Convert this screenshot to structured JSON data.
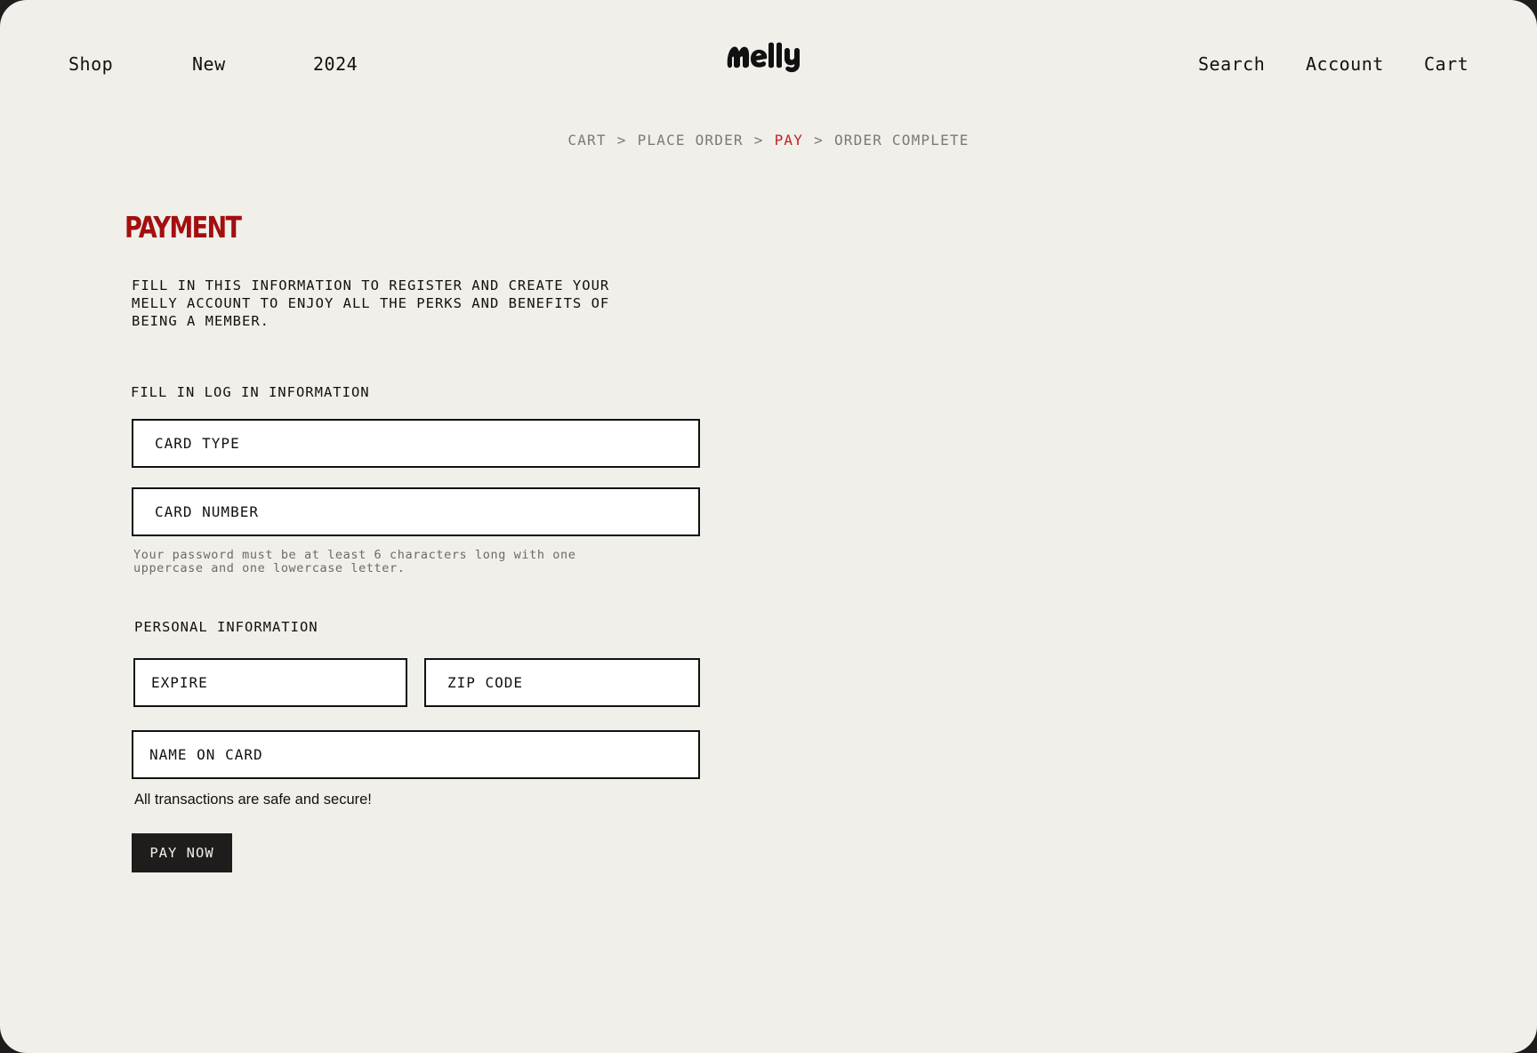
{
  "header": {
    "nav_left": {
      "shop": "Shop",
      "new": "New",
      "year": "2024"
    },
    "logo_text": "Melly",
    "nav_right": {
      "search": "Search",
      "account": "Account",
      "cart": "Cart"
    }
  },
  "breadcrumb": {
    "steps": [
      "CART",
      "PLACE ORDER",
      "PAY",
      "ORDER COMPLETE"
    ],
    "active_step": "PAY",
    "separator": ">"
  },
  "page": {
    "title": "PAYMENT",
    "intro": "FILL IN THIS INFORMATION TO REGISTER AND CREATE YOUR MELLY ACCOUNT TO ENJOY ALL THE PERKS AND BENEFITS OF BEING A MEMBER."
  },
  "login_section": {
    "label": "FILL IN LOG IN INFORMATION",
    "card_type_placeholder": "CARD TYPE",
    "card_number_placeholder": "CARD NUMBER",
    "hint": "Your password must be at least 6 characters long with one uppercase and one lowercase letter."
  },
  "personal_section": {
    "label": "PERSONAL INFORMATION",
    "expire_placeholder": "EXPIRE",
    "zip_placeholder": "ZIP CODE",
    "name_placeholder": "NAME ON CARD"
  },
  "footer": {
    "secure_text": "All transactions are safe and secure!",
    "pay_button": "PAY NOW"
  },
  "colors": {
    "background": "#f0efea",
    "accent_red": "#a30f0f",
    "active_breadcrumb": "#c22323",
    "button_bg": "#1e1d1b"
  }
}
